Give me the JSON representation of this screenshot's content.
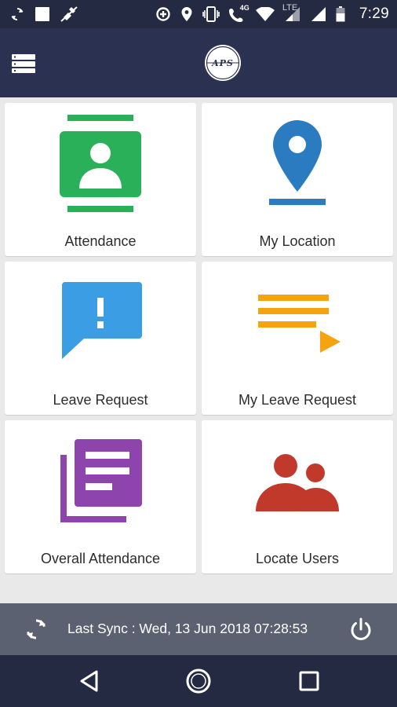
{
  "status_bar": {
    "time": "7:29",
    "network_label": "4G",
    "lte_label": "LTE",
    "left_icons": [
      "sync-icon",
      "notification-square-icon",
      "satellite-off-icon"
    ],
    "right_icons": [
      "data-saver-icon",
      "location-pin-icon",
      "vibrate-icon",
      "4g-call-icon",
      "wifi-icon",
      "lte-signal-icon",
      "signal-icon",
      "battery-icon"
    ]
  },
  "app_bar": {
    "menu_icon": "menu-list-icon",
    "logo_text": "APS"
  },
  "tiles": [
    {
      "label": "Attendance",
      "icon": "attendance-contact-card-icon",
      "color": "#2bb05a"
    },
    {
      "label": "My Location",
      "icon": "map-pin-icon",
      "color": "#2b7bc0"
    },
    {
      "label": "Leave Request",
      "icon": "alert-speech-bubble-icon",
      "color": "#3b9de3"
    },
    {
      "label": "My Leave Request",
      "icon": "playlist-icon",
      "color": "#f5a30f"
    },
    {
      "label": "Overall Attendance",
      "icon": "stacked-documents-icon",
      "color": "#8e44ad"
    },
    {
      "label": "Locate Users",
      "icon": "users-group-icon",
      "color": "#c0392b"
    }
  ],
  "sync_bar": {
    "text": "Last Sync : Wed, 13 Jun 2018 07:28:53",
    "sync_icon": "sync-icon",
    "power_icon": "power-icon"
  },
  "nav_bar": {
    "back": "back-triangle-icon",
    "home": "home-circle-icon",
    "recents": "recents-square-icon"
  },
  "colors": {
    "status_bar": "#242a42",
    "app_bar": "#2b3150",
    "background": "#e9e9ea",
    "sync_bar": "#5c6172",
    "nav_bar": "#242a42"
  }
}
